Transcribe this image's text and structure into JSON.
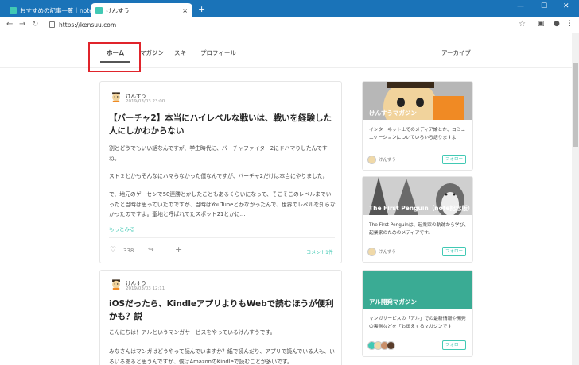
{
  "browser": {
    "tabs": [
      {
        "title": "おすすめの記事一覧｜note ーーつ"
      },
      {
        "title": "けんすう"
      }
    ],
    "new_tab": "+",
    "url": "https://kensuu.com",
    "window_controls": [
      "—",
      "☐",
      "✕"
    ]
  },
  "subnav": {
    "items": [
      "ホーム",
      "マガジン",
      "スキ",
      "プロフィール"
    ],
    "archive": "アーカイブ"
  },
  "posts": [
    {
      "author": "けんすう",
      "date": "2019/03/03 23:00",
      "title": "【バーチャ2】本当にハイレベルな戦いは、戦いを経験した人にしかわからない",
      "paragraphs": [
        "割とどうでもいい話なんですが、学生時代に、バーチャファイター2にドハマりしたんですね。",
        "スト２とかもそんなにハマらなかった僕なんですが、バーチャ2だけは本当にやりました。",
        "で、地元のゲーセンで50連勝とかしたこともあるくらいになって、そこそこのレベルまでいったと当時は思っていたのですが、当時はYouTubeとかなかったんで、世界のレベルを知らなかったのですよ。聖地と呼ばれてたスポット21とかに…"
      ],
      "more": "もっとみる",
      "likes": "338",
      "comments": "コメント1件"
    },
    {
      "author": "けんすう",
      "date": "2019/03/03 12:11",
      "title": "iOSだったら、KindleアプリよりもWebで読むほうが便利かも？説",
      "paragraphs": [
        "こんにちは！アルというマンガサービスをやっているけんすうです。",
        "みなさんはマンガはどうやって読んでいますか？紙で読んだり、アプリで読んでいる人も、いろいろあると思うんですが、僕はAmazonのKindleで読むことが多いです。"
      ]
    }
  ],
  "magazines": [
    {
      "name": "けんすうマガジン",
      "description": "インターネット上でのメディア論とか、コミュニケーションについていろいろ語りますよ",
      "author": "けんすう",
      "follow": "フォロー"
    },
    {
      "name": "The First Penguin（note記念版）",
      "description": "The First Penguinは、起業家の軌跡から学び、起業家のためのメディアです。",
      "author": "けんすう",
      "follow": "フォロー"
    },
    {
      "name": "アル開発マガジン",
      "description": "マンガサービスの「アル」での最新情報や開発の裏側などを「お伝えするマガジンです！",
      "follow": "フォロー"
    }
  ],
  "colors": {
    "accent": "#41c9b4",
    "highlight": "#e0242b",
    "titlebar": "#1a73b8",
    "teal_cover": "#3aab94"
  }
}
